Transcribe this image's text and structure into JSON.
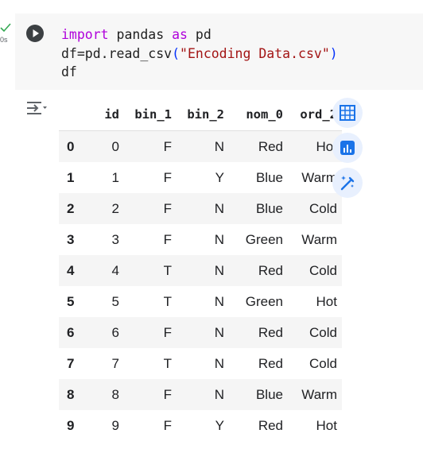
{
  "cell": {
    "exec_time": "0s",
    "code": {
      "line1": {
        "kw1": "import",
        "mid": " pandas ",
        "kw2": "as",
        "end": " pd"
      },
      "line2": {
        "pre": "df=pd.read_csv",
        "open": "(",
        "str": "\"Encoding Data.csv\"",
        "close": ")"
      },
      "line3": "df"
    }
  },
  "dataframe": {
    "columns": [
      "id",
      "bin_1",
      "bin_2",
      "nom_0",
      "ord_2"
    ],
    "rows": [
      {
        "index": "0",
        "cells": [
          "0",
          "F",
          "N",
          "Red",
          "Hot"
        ]
      },
      {
        "index": "1",
        "cells": [
          "1",
          "F",
          "Y",
          "Blue",
          "Warm"
        ]
      },
      {
        "index": "2",
        "cells": [
          "2",
          "F",
          "N",
          "Blue",
          "Cold"
        ]
      },
      {
        "index": "3",
        "cells": [
          "3",
          "F",
          "N",
          "Green",
          "Warm"
        ]
      },
      {
        "index": "4",
        "cells": [
          "4",
          "T",
          "N",
          "Red",
          "Cold"
        ]
      },
      {
        "index": "5",
        "cells": [
          "5",
          "T",
          "N",
          "Green",
          "Hot"
        ]
      },
      {
        "index": "6",
        "cells": [
          "6",
          "F",
          "N",
          "Red",
          "Cold"
        ]
      },
      {
        "index": "7",
        "cells": [
          "7",
          "T",
          "N",
          "Red",
          "Cold"
        ]
      },
      {
        "index": "8",
        "cells": [
          "8",
          "F",
          "N",
          "Blue",
          "Warm"
        ]
      },
      {
        "index": "9",
        "cells": [
          "9",
          "F",
          "Y",
          "Red",
          "Hot"
        ]
      }
    ]
  },
  "icons": {
    "run": "play-circle-icon",
    "status": "check-icon",
    "output_menu": "output-options-icon",
    "table": "table-icon",
    "chart": "bar-chart-icon",
    "magic": "magic-wand-icon"
  },
  "colors": {
    "accent": "#1a73e8",
    "keyword": "#af00db",
    "string": "#a31515",
    "success": "#34a853"
  }
}
